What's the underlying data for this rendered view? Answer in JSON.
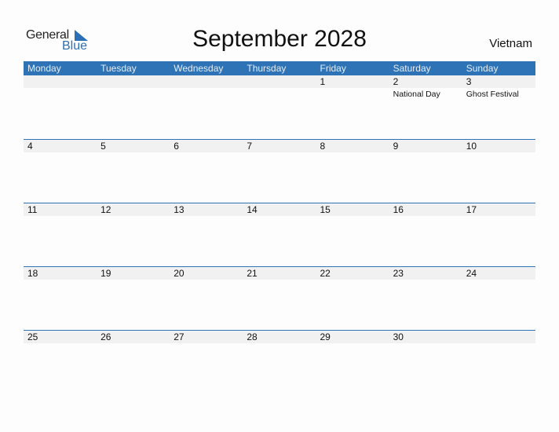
{
  "logo": {
    "general": "General",
    "blue": "Blue"
  },
  "title": "September 2028",
  "country": "Vietnam",
  "colors": {
    "accent": "#2e73b5",
    "date_strip": "#f1f1f1"
  },
  "weekdays": [
    "Monday",
    "Tuesday",
    "Wednesday",
    "Thursday",
    "Friday",
    "Saturday",
    "Sunday"
  ],
  "weeks": [
    [
      {
        "day": ""
      },
      {
        "day": ""
      },
      {
        "day": ""
      },
      {
        "day": ""
      },
      {
        "day": "1"
      },
      {
        "day": "2",
        "event": "National Day"
      },
      {
        "day": "3",
        "event": "Ghost Festival"
      }
    ],
    [
      {
        "day": "4"
      },
      {
        "day": "5"
      },
      {
        "day": "6"
      },
      {
        "day": "7"
      },
      {
        "day": "8"
      },
      {
        "day": "9"
      },
      {
        "day": "10"
      }
    ],
    [
      {
        "day": "11"
      },
      {
        "day": "12"
      },
      {
        "day": "13"
      },
      {
        "day": "14"
      },
      {
        "day": "15"
      },
      {
        "day": "16"
      },
      {
        "day": "17"
      }
    ],
    [
      {
        "day": "18"
      },
      {
        "day": "19"
      },
      {
        "day": "20"
      },
      {
        "day": "21"
      },
      {
        "day": "22"
      },
      {
        "day": "23"
      },
      {
        "day": "24"
      }
    ],
    [
      {
        "day": "25"
      },
      {
        "day": "26"
      },
      {
        "day": "27"
      },
      {
        "day": "28"
      },
      {
        "day": "29"
      },
      {
        "day": "30"
      },
      {
        "day": ""
      }
    ]
  ]
}
